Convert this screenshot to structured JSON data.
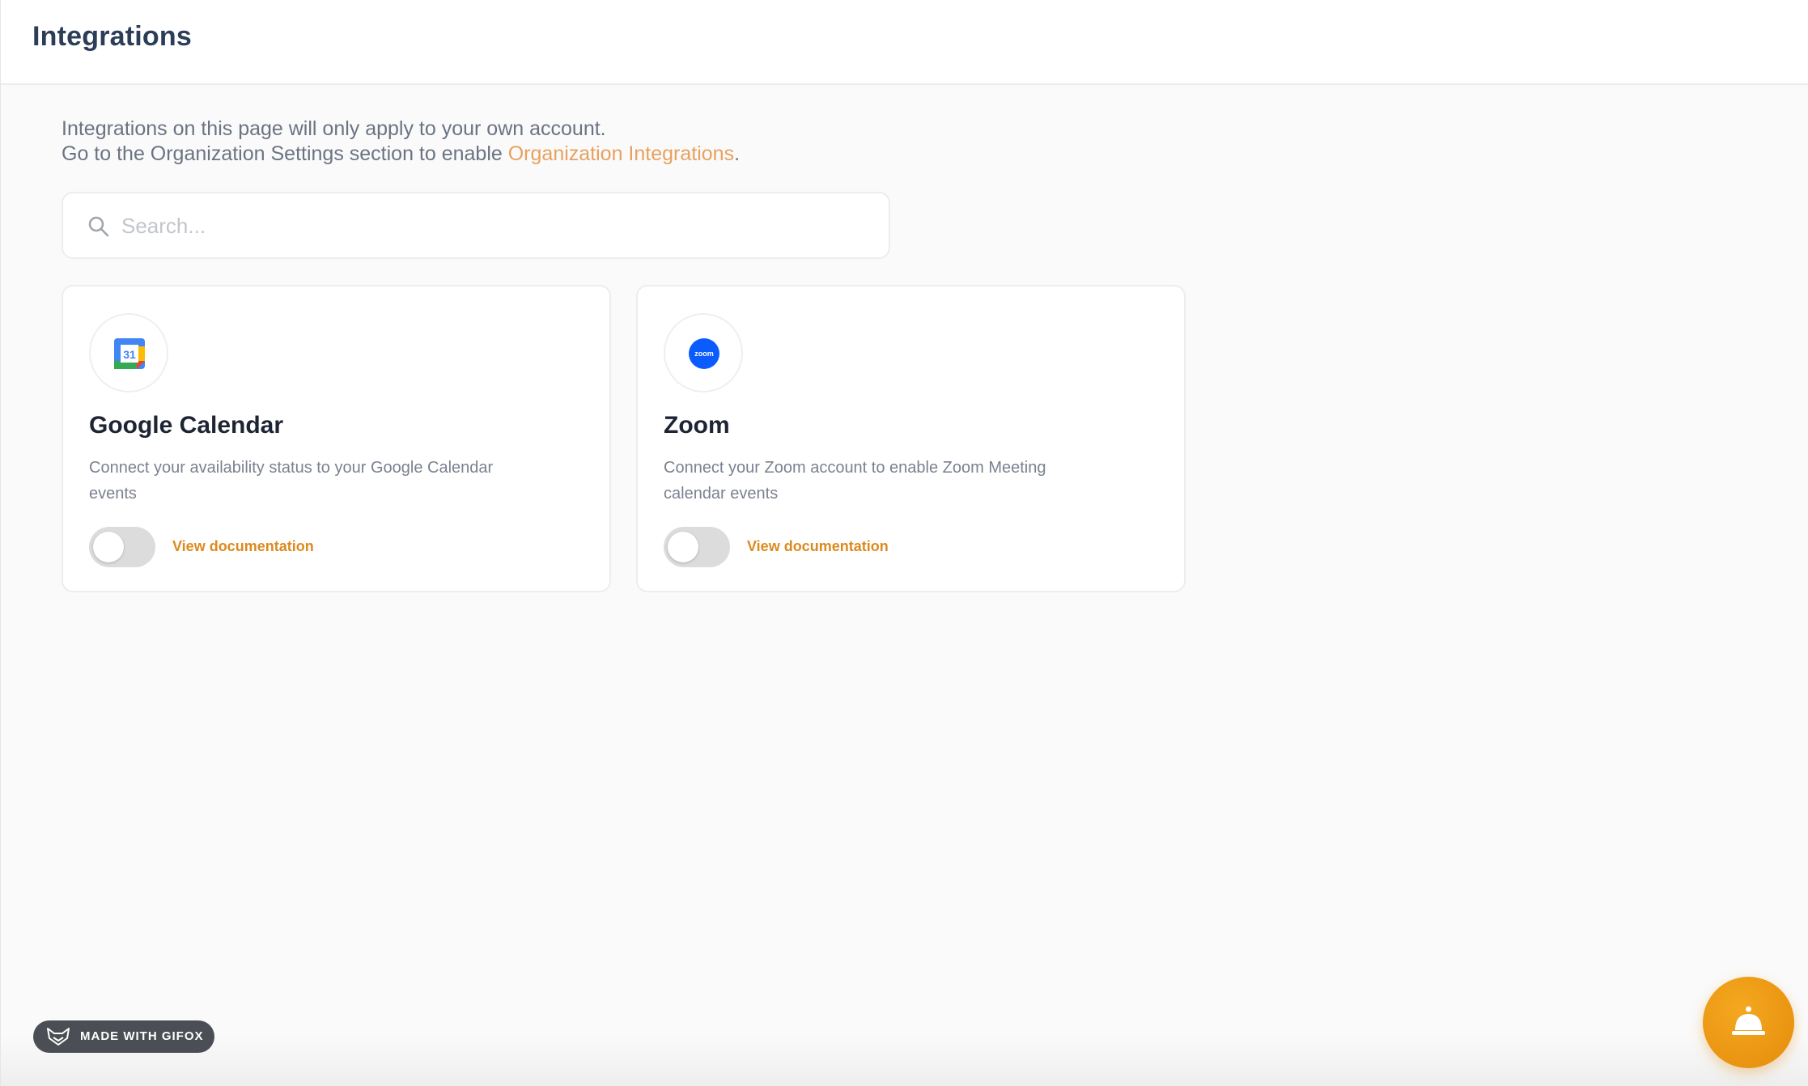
{
  "header": {
    "title": "Integrations"
  },
  "intro": {
    "line1": "Integrations on this page will only apply to your own account.",
    "line2_prefix": "Go to the Organization Settings section to enable ",
    "line2_link": "Organization Integrations",
    "line2_suffix": "."
  },
  "search": {
    "placeholder": "Search...",
    "value": ""
  },
  "integrations": [
    {
      "name": "Google Calendar",
      "description": "Connect your availability status to your Google Calendar events",
      "logo_icon": "google-calendar-icon",
      "logo_text": "31",
      "enabled": false,
      "doc_link": "View documentation"
    },
    {
      "name": "Zoom",
      "description": "Connect your Zoom account to enable Zoom Meeting calendar events",
      "logo_icon": "zoom-icon",
      "logo_text": "zoom",
      "enabled": false,
      "doc_link": "View documentation"
    }
  ],
  "watermark": {
    "text": "MADE WITH GIFOX"
  },
  "help_button": {
    "icon": "bell-icon"
  },
  "colors": {
    "accent_link": "#e8a15e",
    "doc_link": "#dc8a1e",
    "help_button": "#f0a018",
    "zoom_blue": "#0b5cff"
  }
}
